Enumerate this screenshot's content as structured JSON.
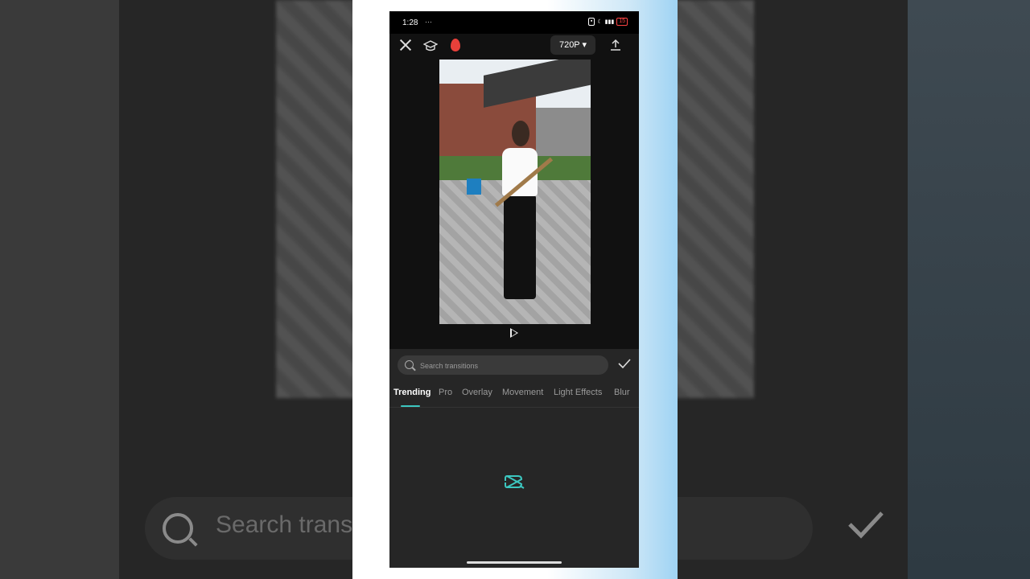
{
  "status_bar": {
    "time": "1:28",
    "more": "···",
    "battery": "15"
  },
  "editor": {
    "resolution": "720P"
  },
  "transitions": {
    "search_placeholder": "Search transitions",
    "tabs": [
      "Trending",
      "Pro",
      "Overlay",
      "Movement",
      "Light Effects",
      "Blur"
    ],
    "active_tab": "Trending"
  },
  "backdrop": {
    "search_text": "Search transi"
  },
  "colors": {
    "accent": "#3cc7c0",
    "flame": "#e8403a"
  }
}
